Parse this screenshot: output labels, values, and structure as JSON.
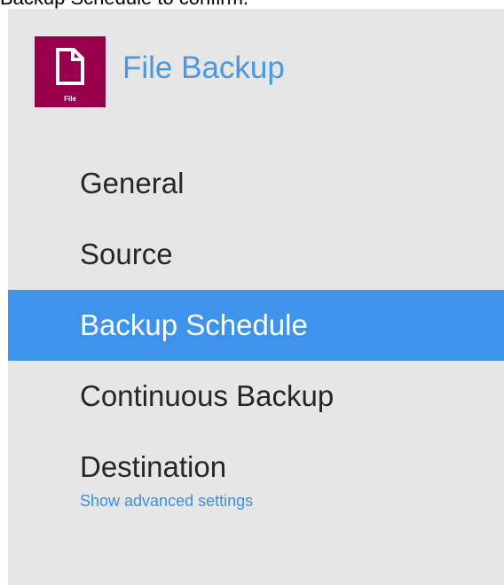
{
  "caption": "Backup Schedule to confirm.",
  "header": {
    "title": "File Backup",
    "icon_name": "file-icon",
    "icon_label": "File",
    "icon_color": "#99004c"
  },
  "nav": {
    "items": [
      {
        "label": "General"
      },
      {
        "label": "Source"
      },
      {
        "label": "Backup Schedule"
      },
      {
        "label": "Continuous Backup"
      },
      {
        "label": "Destination"
      }
    ],
    "active_index": 2
  },
  "advanced_link": "Show advanced settings",
  "colors": {
    "panel_bg": "#e6e6e6",
    "accent": "#3d94ea",
    "title_blue": "#4a98e3",
    "link_blue": "#3b8fde"
  }
}
